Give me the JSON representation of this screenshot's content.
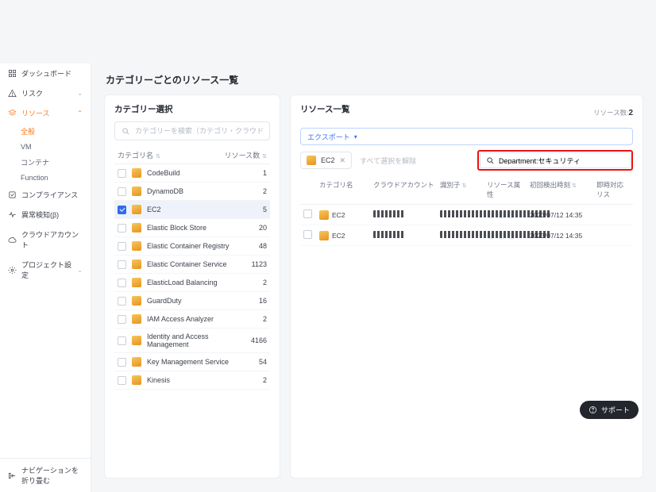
{
  "sidebar": {
    "items": [
      {
        "label": "ダッシュボード",
        "icon": "grid",
        "expandable": false
      },
      {
        "label": "リスク",
        "icon": "warning",
        "expandable": true
      },
      {
        "label": "リソース",
        "icon": "layers",
        "expandable": true,
        "active": true,
        "expanded": true
      },
      {
        "label": "コンプライアンス",
        "icon": "check",
        "expandable": false
      },
      {
        "label": "異常検知(β)",
        "icon": "pulse",
        "expandable": false
      },
      {
        "label": "クラウドアカウント",
        "icon": "cloud",
        "expandable": false
      },
      {
        "label": "プロジェクト設定",
        "icon": "gear",
        "expandable": true
      }
    ],
    "resource_sub": [
      {
        "label": "全般",
        "active": true
      },
      {
        "label": "VM"
      },
      {
        "label": "コンテナ"
      },
      {
        "label": "Function"
      }
    ],
    "collapse_label": "ナビゲーションを折り畳む"
  },
  "page": {
    "title": "カテゴリーごとのリソース一覧"
  },
  "category_panel": {
    "title": "カテゴリー選択",
    "search_placeholder": "カテゴリーを検索（カテゴリ・クラウド名）",
    "head_name": "カテゴリ名",
    "head_count": "リソース数",
    "rows": [
      {
        "name": "CodeBuild",
        "count": "1",
        "checked": false
      },
      {
        "name": "DynamoDB",
        "count": "2",
        "checked": false
      },
      {
        "name": "EC2",
        "count": "5",
        "checked": true
      },
      {
        "name": "Elastic Block Store",
        "count": "20",
        "checked": false
      },
      {
        "name": "Elastic Container Registry",
        "count": "48",
        "checked": false
      },
      {
        "name": "Elastic Container Service",
        "count": "1123",
        "checked": false
      },
      {
        "name": "ElasticLoad Balancing",
        "count": "2",
        "checked": false
      },
      {
        "name": "GuardDuty",
        "count": "16",
        "checked": false
      },
      {
        "name": "IAM Access Analyzer",
        "count": "2",
        "checked": false
      },
      {
        "name": "Identity and Access Management",
        "count": "4166",
        "checked": false
      },
      {
        "name": "Key Management Service",
        "count": "54",
        "checked": false
      },
      {
        "name": "Kinesis",
        "count": "2",
        "checked": false
      }
    ]
  },
  "resource_panel": {
    "title": "リソース一覧",
    "count_label": "リソース数:",
    "count_value": "2",
    "export_label": "エクスポート",
    "chip_label": "EC2",
    "clear_label": "すべて選択を解除",
    "search_value": "Department:セキュリティ",
    "columns": {
      "category": "カテゴリ名",
      "account": "クラウドアカウント",
      "identifier": "識別子",
      "attrs": "リソース属性",
      "first_seen": "初回検出時刻",
      "immediate": "即時対応リス"
    },
    "rows": [
      {
        "category": "EC2",
        "time": "2023/07/12 14:35"
      },
      {
        "category": "EC2",
        "time": "2023/07/12 14:35"
      }
    ]
  },
  "support": {
    "label": "サポート"
  }
}
